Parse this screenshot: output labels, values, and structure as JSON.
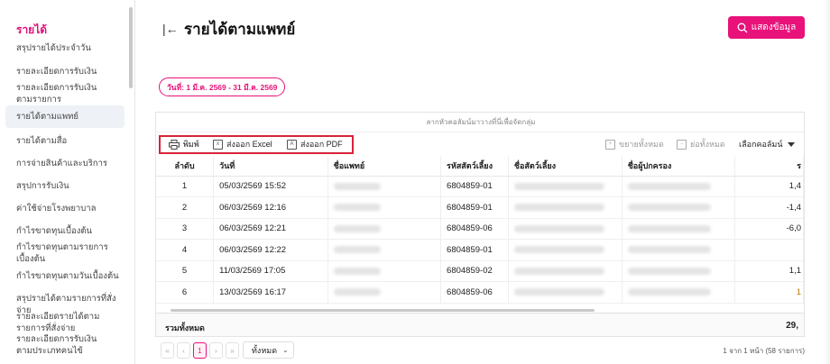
{
  "sidebar": {
    "title": "รายได้",
    "items": [
      {
        "label": "สรุปรายได้ประจำวัน"
      },
      {
        "label": "รายละเอียดการรับเงิน"
      },
      {
        "label": "รายละเอียดการรับเงินตามรายการ"
      },
      {
        "label": "รายได้ตามแพทย์"
      },
      {
        "label": "รายได้ตามสื่อ"
      },
      {
        "label": "การจ่ายสินค้าและบริการ"
      },
      {
        "label": "สรุปการรับเงิน"
      },
      {
        "label": "ค่าใช้จ่ายโรงพยาบาล"
      },
      {
        "label": "กำไรขาดทุนเบื้องต้น"
      },
      {
        "label": "กำไรขาดทุนตามรายการเบื้องต้น"
      },
      {
        "label": "กำไรขาดทุนตามวันเบื้องต้น"
      },
      {
        "label": "สรุปรายได้ตามรายการที่สั่งจ่าย"
      },
      {
        "label": "รายละเอียดรายได้ตามรายการที่สั่งจ่าย"
      },
      {
        "label": "รายละเอียดการรับเงินตามประเภทคนไข้"
      }
    ]
  },
  "header": {
    "title": "รายได้ตามแพทย์",
    "show_button": "แสดงข้อมูล",
    "date_range": "วันที่: 1 มี.ค. 2569 - 31 มี.ค. 2569"
  },
  "table": {
    "drag_hint": "ลากหัวคอลัมน์มาวางที่นี่เพื่อจัดกลุ่ม",
    "toolbar": {
      "print": "พิมพ์",
      "export_excel": "ส่งออก Excel",
      "export_pdf": "ส่งออก PDF",
      "expand_all": "ขยายทั้งหมด",
      "collapse_all": "ย่อทั้งหมด",
      "choose_columns": "เลือกคอลัมน์"
    },
    "columns": [
      "ลำดับ",
      "วันที่",
      "ชื่อแพทย์",
      "รหัสสัตว์เลี้ยง",
      "ชื่อสัตว์เลี้ยง",
      "ชื่อผู้ปกครอง",
      "ร"
    ],
    "rows": [
      {
        "no": "1",
        "date": "05/03/2569 15:52",
        "pet_code": "6804859-01",
        "amount": "1,4"
      },
      {
        "no": "2",
        "date": "06/03/2569 12:16",
        "pet_code": "6804859-01",
        "amount": "-1,4"
      },
      {
        "no": "3",
        "date": "06/03/2569 12:21",
        "pet_code": "6804859-06",
        "amount": "-6,0"
      },
      {
        "no": "4",
        "date": "06/03/2569 12:22",
        "pet_code": "6804859-01",
        "amount": ""
      },
      {
        "no": "5",
        "date": "11/03/2569 17:05",
        "pet_code": "6804859-02",
        "amount": "1,1"
      },
      {
        "no": "6",
        "date": "13/03/2569 16:17",
        "pet_code": "6804859-06",
        "amount": "1"
      }
    ],
    "total_label": "รวมทั้งหมด",
    "total_value": "29,"
  },
  "pagination": {
    "first": "«",
    "prev": "‹",
    "current": "1",
    "next": "›",
    "last": "»",
    "page_size": "ทั้งหมด",
    "info": "1 จาก 1 หน้า (58 รายการ)"
  },
  "colors": {
    "accent": "#e8127a",
    "highlight_border": "#d9233a"
  }
}
